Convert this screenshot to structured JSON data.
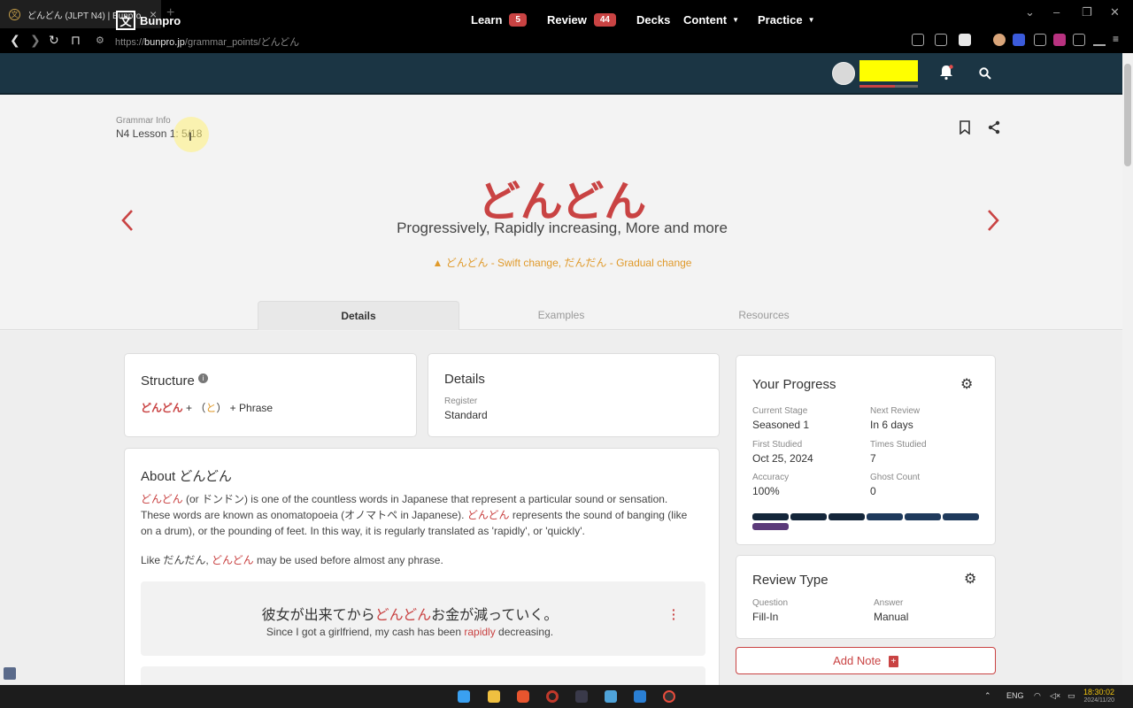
{
  "browser": {
    "tab_title": "どんどん (JLPT N4) | Bunpro",
    "url_host": "bunpro.jp",
    "url_path": "/grammar_points/どんどん",
    "url_scheme": "https://"
  },
  "header": {
    "logo_mark": "文",
    "logo_text": "Bunpro",
    "learn_label": "Learn",
    "learn_count": "5",
    "review_label": "Review",
    "review_count": "44",
    "decks_label": "Decks",
    "content_label": "Content",
    "practice_label": "Practice"
  },
  "grammar": {
    "info_label": "Grammar Info",
    "lesson": "N4 Lesson 1: 5/18",
    "title": "どんどん",
    "meaning": "Progressively, Rapidly increasing, More and more",
    "warning": "どんどん - Swift change, だんだん - Gradual change"
  },
  "page_tabs": [
    "Details",
    "Examples",
    "Resources"
  ],
  "structure": {
    "heading": "Structure",
    "part1": "どんどん",
    "part2": "+ （",
    "part3": "と",
    "part4": "） + Phrase"
  },
  "details": {
    "heading": "Details",
    "register_label": "Register",
    "register_value": "Standard"
  },
  "about": {
    "heading": "About どんどん",
    "p1_a": "どんどん",
    "p1_b": " (or ドンドン) is one of the countless words in Japanese that represent a particular sound or sensation.",
    "p1_c": "These words are known as onomatopoeia (オノマトペ in Japanese). ",
    "p1_d": "どんどん",
    "p1_e": " represents the sound of banging (like",
    "p1_f": "on a drum), or the pounding of feet. In this way, it is regularly translated as 'rapidly', or 'quickly'.",
    "p2_a": "Like だんだん, ",
    "p2_b": "どんどん",
    "p2_c": " may be used before almost any phrase."
  },
  "example": {
    "jp_a": "彼女が出来てから",
    "jp_b": "どんどん",
    "jp_c": "お金が減っていく。",
    "en_a": "Since I got a girlfriend, my cash has been ",
    "en_b": "rapidly",
    "en_c": " decreasing."
  },
  "progress": {
    "heading": "Your Progress",
    "current_stage_label": "Current Stage",
    "current_stage": "Seasoned 1",
    "next_review_label": "Next Review",
    "next_review": "In 6 days",
    "first_studied_label": "First Studied",
    "first_studied": "Oct 25, 2024",
    "times_studied_label": "Times Studied",
    "times_studied": "7",
    "accuracy_label": "Accuracy",
    "accuracy": "100%",
    "ghost_label": "Ghost Count",
    "ghost": "0",
    "segment_colors": [
      "#14263a",
      "#14263a",
      "#14263a",
      "#1f3a5c",
      "#1f3a5c",
      "#1f3a5c",
      "#5b3a7a"
    ]
  },
  "review_type": {
    "heading": "Review Type",
    "question_label": "Question",
    "question": "Fill-In",
    "answer_label": "Answer",
    "answer": "Manual"
  },
  "add_note": "Add Note",
  "taskbar": {
    "lang": "ENG",
    "time": "18:30:02",
    "date": "2024/11/20"
  }
}
